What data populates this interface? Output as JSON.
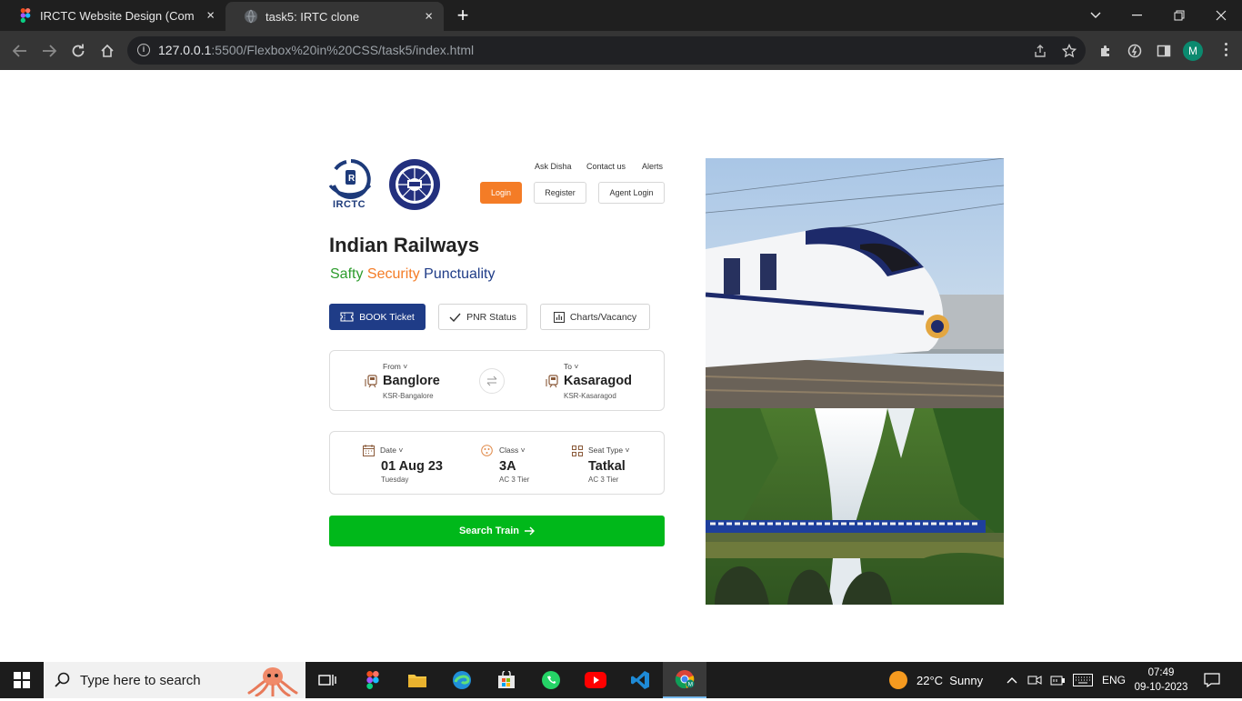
{
  "browser": {
    "tabs": [
      {
        "title": "IRCTC Website Design (Commun",
        "close": "×"
      },
      {
        "title": "task5: IRTC clone",
        "close": "×"
      }
    ],
    "new_tab": "+",
    "url_host": "127.0.0.1",
    "url_rest": ":5500/Flexbox%20in%20CSS/task5/index.html",
    "avatar_letter": "M"
  },
  "header": {
    "logo_irctc_text": "IRCTC",
    "links": [
      "Ask Disha",
      "Contact us",
      "Alerts"
    ],
    "login": "Login",
    "register": "Register",
    "agent_login": "Agent Login"
  },
  "hero_text": {
    "title": "Indian Railways",
    "tag1": "Safty",
    "tag2": "Security",
    "tag3": "Punctuality"
  },
  "actions": {
    "book": "BOOK Ticket",
    "pnr": "PNR Status",
    "charts": "Charts/Vacancy"
  },
  "route": {
    "from_label": "From",
    "from_value": "Banglore",
    "from_station": "KSR-Bangalore",
    "to_label": "To",
    "to_value": "Kasaragod",
    "to_station": "KSR-Kasaragod"
  },
  "journey": {
    "date_label": "Date",
    "date_value": "01 Aug 23",
    "date_sub": "Tuesday",
    "class_label": "Class",
    "class_value": "3A",
    "class_sub": "AC 3 Tier",
    "seat_label": "Seat Type",
    "seat_value": "Tatkal",
    "seat_sub": "AC 3 Tier"
  },
  "search": {
    "label": "Search Train"
  },
  "taskbar": {
    "search_placeholder": "Type here to search",
    "weather": "22°C  Sunny",
    "lang": "ENG",
    "time": "07:49",
    "date": "09-10-2023"
  },
  "colors": {
    "accent_orange": "#f47c26",
    "brand_blue": "#1f3c87",
    "search_green": "#00b81a"
  }
}
